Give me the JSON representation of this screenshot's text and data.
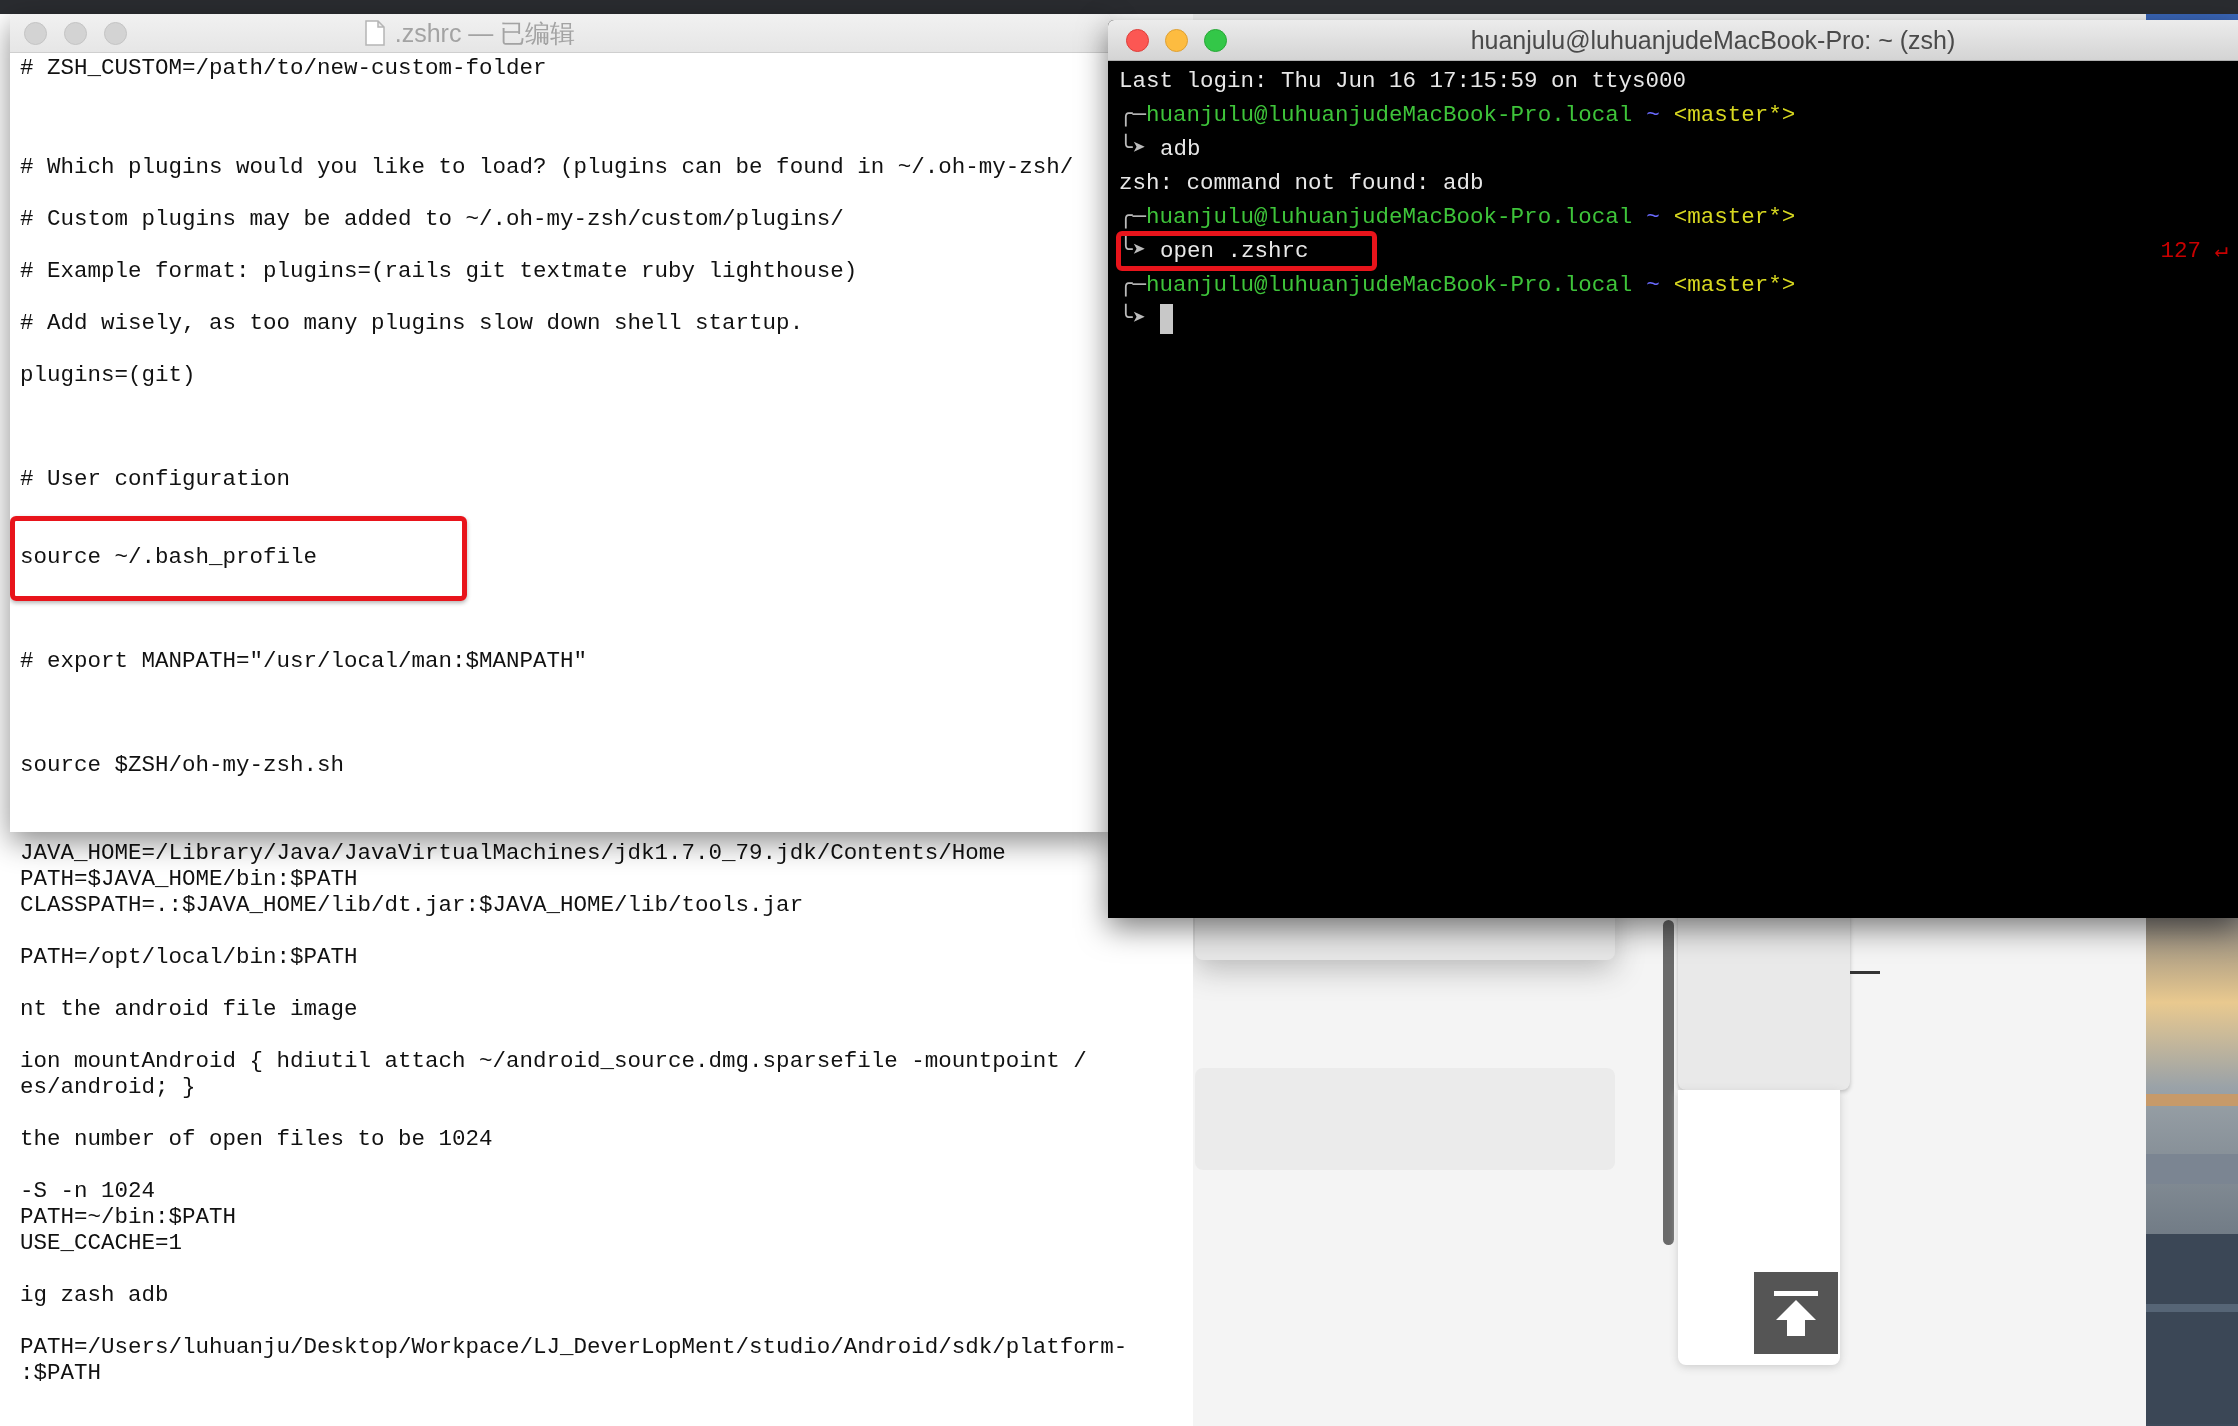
{
  "background_editor": {
    "lines": [
      {
        "kind": "text",
        "text": "JAVA_HOME=/Library/Java/JavaVirtualMachines/jdk1.7.0_79.jdk/Contents/Home"
      },
      {
        "kind": "text",
        "text": "PATH=$JAVA_HOME/bin:$PATH"
      },
      {
        "kind": "text",
        "text": "CLASSPATH=.:$JAVA_HOME/lib/dt.jar:$JAVA_HOME/lib/tools.jar"
      },
      {
        "kind": "blank"
      },
      {
        "kind": "text",
        "text": "PATH=/opt/local/bin:$PATH"
      },
      {
        "kind": "blank"
      },
      {
        "kind": "text",
        "text": "nt the android file image"
      },
      {
        "kind": "blank"
      },
      {
        "kind": "text",
        "text": "ion mountAndroid { hdiutil attach ~/android_source.dmg.sparsefile -mountpoint /"
      },
      {
        "kind": "text",
        "text": "es/android; }"
      },
      {
        "kind": "blank"
      },
      {
        "kind": "text",
        "text": "the number of open files to be 1024"
      },
      {
        "kind": "blank"
      },
      {
        "kind": "text",
        "text": "-S -n 1024"
      },
      {
        "kind": "text",
        "text": "PATH=~/bin:$PATH"
      },
      {
        "kind": "text",
        "text": "USE_CCACHE=1"
      },
      {
        "kind": "blank"
      },
      {
        "kind": "text",
        "text": "ig zash adb"
      },
      {
        "kind": "blank"
      },
      {
        "kind": "text",
        "text": "PATH=/Users/luhuanju/Desktop/Workpace/LJ_DeverLopMent/studio/Android/sdk/platform-"
      },
      {
        "kind": "text",
        "text": ":$PATH"
      }
    ]
  },
  "editor": {
    "title": ".zshrc — 已编辑",
    "lines": [
      {
        "kind": "text",
        "text": "# ZSH_CUSTOM=/path/to/new-custom-folder",
        "highlighted": false
      },
      {
        "kind": "blank"
      },
      {
        "kind": "blank"
      },
      {
        "kind": "text",
        "text": "# Which plugins would you like to load? (plugins can be found in ~/.oh-my-zsh/",
        "highlighted": false
      },
      {
        "kind": "text",
        "text": "# Custom plugins may be added to ~/.oh-my-zsh/custom/plugins/",
        "highlighted": false
      },
      {
        "kind": "text",
        "text": "# Example format: plugins=(rails git textmate ruby lighthouse)",
        "highlighted": false
      },
      {
        "kind": "text",
        "text": "# Add wisely, as too many plugins slow down shell startup.",
        "highlighted": false
      },
      {
        "kind": "text",
        "text": "plugins=(git)",
        "highlighted": false
      },
      {
        "kind": "blank"
      },
      {
        "kind": "blank"
      },
      {
        "kind": "text",
        "text": "# User configuration",
        "highlighted": false
      },
      {
        "kind": "blank"
      },
      {
        "kind": "text",
        "text": "source ~/.bash_profile",
        "highlighted": true
      },
      {
        "kind": "blank"
      },
      {
        "kind": "blank"
      },
      {
        "kind": "text",
        "text": "# export MANPATH=\"/usr/local/man:$MANPATH\"",
        "highlighted": false
      },
      {
        "kind": "blank"
      },
      {
        "kind": "blank"
      },
      {
        "kind": "text",
        "text": "source $ZSH/oh-my-zsh.sh",
        "highlighted": false
      }
    ]
  },
  "terminal": {
    "title": "huanjulu@luhuanjudeMacBook-Pro: ~ (zsh)",
    "lines": [
      {
        "kind": "output",
        "text": "Last login: Thu Jun 16 17:15:59 on ttys000"
      },
      {
        "kind": "prompt",
        "corner": "╭─",
        "user_host": "huanjulu@luhuanjudeMacBook-Pro.local",
        "dir": "~",
        "branch": "<master*>"
      },
      {
        "kind": "command",
        "arrow": "╰➤",
        "text": "adb",
        "highlighted": false,
        "cursor": false
      },
      {
        "kind": "output",
        "text": "zsh: command not found: adb"
      },
      {
        "kind": "prompt",
        "corner": "╭─",
        "user_host": "huanjulu@luhuanjudeMacBook-Pro.local",
        "dir": "~",
        "branch": "<master*>"
      },
      {
        "kind": "command",
        "arrow": "╰➤",
        "text": "open .zshrc",
        "highlighted": true,
        "cursor": false,
        "status": "127 ↵"
      },
      {
        "kind": "prompt",
        "corner": "╭─",
        "user_host": "huanjulu@luhuanjudeMacBook-Pro.local",
        "dir": "~",
        "branch": "<master*>"
      },
      {
        "kind": "command",
        "arrow": "╰➤",
        "highlighted": false,
        "cursor": true
      }
    ]
  }
}
